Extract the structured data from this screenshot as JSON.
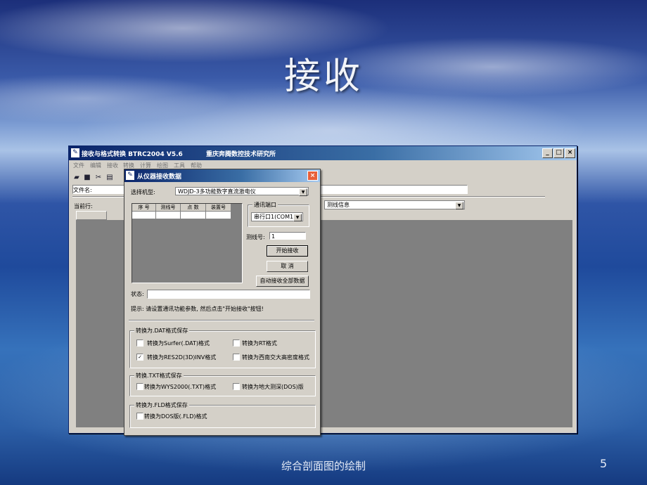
{
  "slide": {
    "title": "接收",
    "footer": "综合剖面图的绘制",
    "page_number": "5"
  },
  "main_window": {
    "title": "接收与格式转换 BTRC2004 V5.6",
    "company": "重庆奔腾数控技术研究所",
    "controls": {
      "minimize": "_",
      "maximize": "□",
      "close": "×"
    },
    "menu": [
      "文件",
      "编辑",
      "接收",
      "转换",
      "计算",
      "绘图",
      "工具",
      "帮助"
    ],
    "toolbar_icons": [
      "open-folder-icon",
      "save-icon",
      "cut-icon",
      "print-icon"
    ],
    "filename_label": "文件名:",
    "current_row_label": "当前行:",
    "info_combo": "测线信息"
  },
  "dialog": {
    "title": "从仪器接收数据",
    "close": "×",
    "model_label": "选择机型:",
    "model_value": "WDJD-3多功能数字直流激电仪",
    "table_headers": [
      "序 号",
      "测线号",
      "点 数",
      "装置号"
    ],
    "port_group": "通讯端口",
    "port_value": "串行口1(COM1)",
    "line_label": "测线号:",
    "line_value": "1",
    "start_button": "开始接收",
    "cancel_button": "取  消",
    "auto_button": "自动接收全部数据",
    "status_label": "状态:",
    "hint": "提示: 请设置通讯功能参数, 然后点击\"开始接收\"按钮!",
    "dat_group": {
      "title": "转换为.DAT格式保存",
      "items": [
        {
          "label": "转换为Surfer(.DAT)格式",
          "checked": false
        },
        {
          "label": "转换为RT格式",
          "checked": false
        },
        {
          "label": "转换为RES2D(3D)INV格式",
          "checked": true
        },
        {
          "label": "转换为西南交大高密度格式",
          "checked": false
        }
      ]
    },
    "txt_group": {
      "title": "转换.TXT格式保存",
      "items": [
        {
          "label": "转换为WYS2000(.TXT)格式",
          "checked": false
        },
        {
          "label": "转换为地大测深(DOS)版",
          "checked": false
        }
      ]
    },
    "fld_group": {
      "title": "转换为.FLD格式保存",
      "items": [
        {
          "label": "转换为DOS版(.FLD)格式",
          "checked": false
        }
      ]
    }
  }
}
